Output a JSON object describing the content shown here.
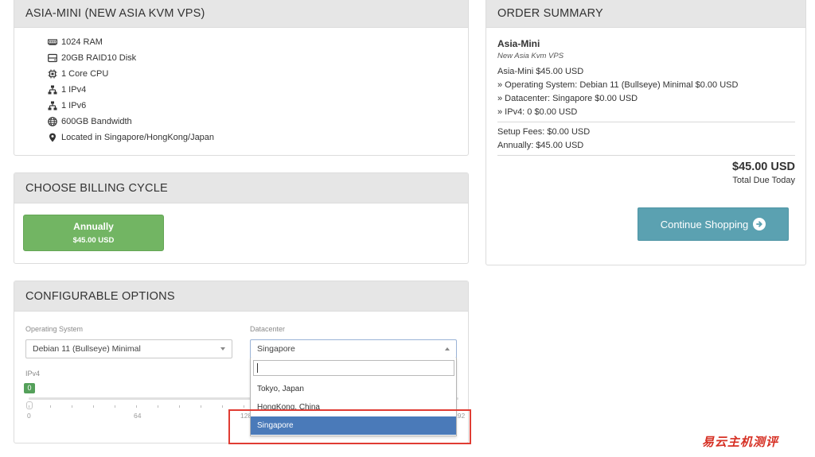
{
  "product": {
    "title": "ASIA-MINI (NEW ASIA KVM VPS)",
    "features": [
      {
        "icon": "memory-icon",
        "text": "1024 RAM"
      },
      {
        "icon": "hard-disk-icon",
        "text": "20GB RAID10 Disk"
      },
      {
        "icon": "cpu-icon",
        "text": "1 Core CPU"
      },
      {
        "icon": "network-icon",
        "text": "1 IPv4"
      },
      {
        "icon": "network-icon",
        "text": "1 IPv6"
      },
      {
        "icon": "globe-icon",
        "text": "600GB Bandwidth"
      },
      {
        "icon": "map-marker-icon",
        "text": "Located in Singapore/HongKong/Japan"
      }
    ]
  },
  "billing": {
    "title": "CHOOSE BILLING CYCLE",
    "option_label": "Annually",
    "option_price": "$45.00 USD"
  },
  "config": {
    "title": "CONFIGURABLE OPTIONS",
    "os_label": "Operating System",
    "os_value": "Debian 11 (Bullseye) Minimal",
    "datacenter_label": "Datacenter",
    "datacenter_value": "Singapore",
    "ipv4_label": "IPv4",
    "ipv4_value": "0",
    "slider_ticks": [
      "0",
      "64",
      "128",
      "192"
    ],
    "dropdown_options": [
      "Tokyo, Japan",
      "HongKong, China",
      "Singapore"
    ],
    "dropdown_selected": "Singapore"
  },
  "order": {
    "title": "ORDER SUMMARY",
    "product_name": "Asia-Mini",
    "product_group": "New Asia Kvm VPS",
    "lines": [
      "Asia-Mini $45.00 USD",
      "» Operating System: Debian 11 (Bullseye) Minimal $0.00 USD",
      "» Datacenter: Singapore $0.00 USD",
      "» IPv4: 0 $0.00 USD"
    ],
    "setup_fees": "Setup Fees: $0.00 USD",
    "annually": "Annually: $45.00 USD",
    "total": "$45.00 USD",
    "total_label": "Total Due Today",
    "continue_label": "Continue Shopping"
  },
  "watermark": "易云主机测评",
  "colors": {
    "panel_header": "#e6e6e6",
    "billing_button": "#72b563",
    "continue_button": "#5ba1b1",
    "dropdown_selected": "#4a7ab9",
    "highlight_box": "#e03c33",
    "slider_bubble": "#54a05a"
  }
}
